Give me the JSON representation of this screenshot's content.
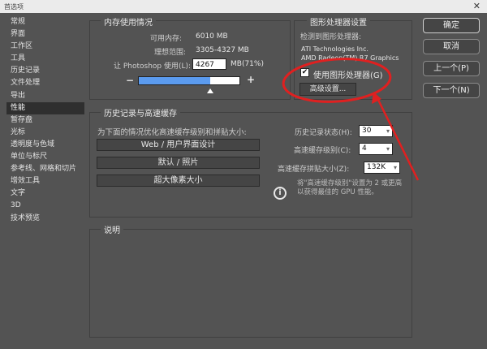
{
  "window": {
    "title": "首选项",
    "close": "✕"
  },
  "sidebar": {
    "items": [
      {
        "label": "常规"
      },
      {
        "label": "界面"
      },
      {
        "label": "工作区"
      },
      {
        "label": "工具"
      },
      {
        "label": "历史记录"
      },
      {
        "label": "文件处理"
      },
      {
        "label": "导出"
      },
      {
        "label": "性能"
      },
      {
        "label": "暂存盘"
      },
      {
        "label": "光标"
      },
      {
        "label": "透明度与色域"
      },
      {
        "label": "单位与标尺"
      },
      {
        "label": "参考线、网格和切片"
      },
      {
        "label": "增效工具"
      },
      {
        "label": "文字"
      },
      {
        "label": "3D"
      },
      {
        "label": "技术预览"
      }
    ],
    "active_index": 7
  },
  "memory": {
    "title": "内存使用情况",
    "available_label": "可用内存:",
    "available_value": "6010 MB",
    "ideal_label": "理想范围:",
    "ideal_value": "3305-4327 MB",
    "let_label": "让 Photoshop 使用(L):",
    "let_value": "4267",
    "let_unit": "MB(71%)",
    "minus": "−",
    "plus": "+",
    "slider_fraction": 0.71
  },
  "gpu": {
    "title": "图形处理器设置",
    "detected_label": "检测到图形处理器:",
    "vendor": "ATI Technologies Inc.",
    "model": "AMD Radeon(TM) R7 Graphics",
    "use_label": "使用图形处理器(G)",
    "use_checked": true,
    "advanced_button": "高级设置..."
  },
  "history_cache": {
    "title": "历史记录与高速缓存",
    "optimize_label": "为下面的情况优化高速缓存级别和拼贴大小:",
    "buttons": [
      "Web / 用户界面设计",
      "默认 / 照片",
      "超大像素大小"
    ],
    "history_states_label": "历史记录状态(H):",
    "history_states_value": "30",
    "cache_levels_label": "高速缓存级别(C):",
    "cache_levels_value": "4",
    "tile_size_label": "高速缓存拼贴大小(Z):",
    "tile_size_value": "132K",
    "info_icon": "i",
    "note": "将\"高速缓存级别\"设置为 2 或更高以获得最佳的 GPU 性能。"
  },
  "description": {
    "title": "说明"
  },
  "dialog_buttons": {
    "ok": "确定",
    "cancel": "取消",
    "prev": "上一个(P)",
    "next": "下一个(N)"
  },
  "colors": {
    "annotation": "#e02020",
    "slider_fill": "#5b9bef",
    "panel_bg": "#535353",
    "active_item_bg": "#2f2f2f"
  }
}
